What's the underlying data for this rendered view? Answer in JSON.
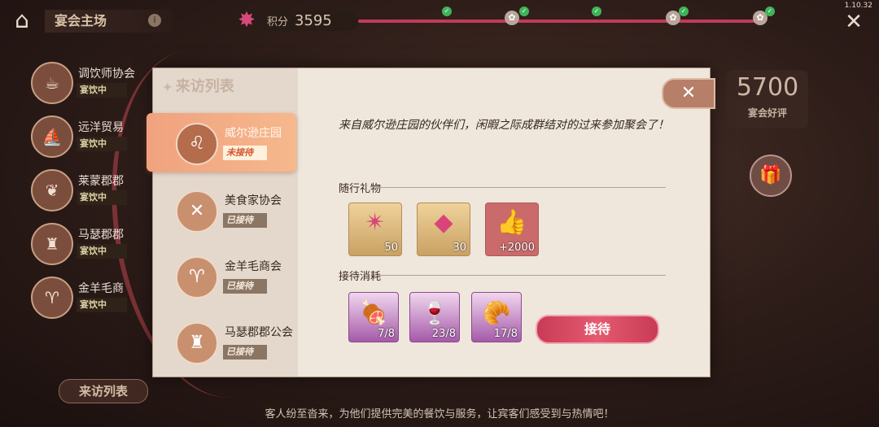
{
  "top_bar": {
    "hall_title": "宴会主场",
    "score_label": "积分",
    "score_value": "3595",
    "version": "1.10.32",
    "progress": 0.98,
    "milestones": [
      {
        "done": true
      },
      {
        "done": true
      },
      {
        "done": true
      },
      {
        "done": true
      },
      {
        "done": true
      }
    ]
  },
  "society_list": [
    {
      "name": "调饮师协会",
      "status": "宴饮中"
    },
    {
      "name": "远洋贸易",
      "status": "宴饮中"
    },
    {
      "name": "莱蒙郡郡",
      "status": "宴饮中"
    },
    {
      "name": "马瑟郡郡",
      "status": "宴饮中"
    },
    {
      "name": "金羊毛商",
      "status": "宴饮中"
    }
  ],
  "left_bottom_button": "来访列表",
  "right_panel": {
    "score": "5700",
    "score_label": "宴会好评"
  },
  "bottom_hint": "客人纷至沓来，为他们提供完美的餐饮与服务，让宾客们感受到与热情吧！",
  "dialog": {
    "title": "来访列表",
    "visitors": [
      {
        "name": "威尔逊庄园",
        "status": "未接待",
        "active": true
      },
      {
        "name": "美食家协会",
        "status": "已接待",
        "active": false
      },
      {
        "name": "金羊毛商会",
        "status": "已接待",
        "active": false
      },
      {
        "name": "马瑟郡郡公会",
        "status": "已接待",
        "active": false
      }
    ],
    "description": "来自威尔逊庄园的伙伴们，闲暇之际成群结对的过来参加聚会了！",
    "gifts_label": "随行礼物",
    "gifts": [
      {
        "icon": "pink-star-gem-icon",
        "qty": "50"
      },
      {
        "icon": "pink-diamond-star-icon",
        "qty": "30"
      },
      {
        "icon": "thumbs-up-icon",
        "qty": "+2000"
      }
    ],
    "cost_label": "接待消耗",
    "costs": [
      {
        "icon": "roast-meat-plate-icon",
        "qty": "7/8"
      },
      {
        "icon": "red-cocktail-icon",
        "qty": "23/8"
      },
      {
        "icon": "pastry-tray-icon",
        "qty": "17/8"
      }
    ],
    "receive_button": "接待"
  }
}
